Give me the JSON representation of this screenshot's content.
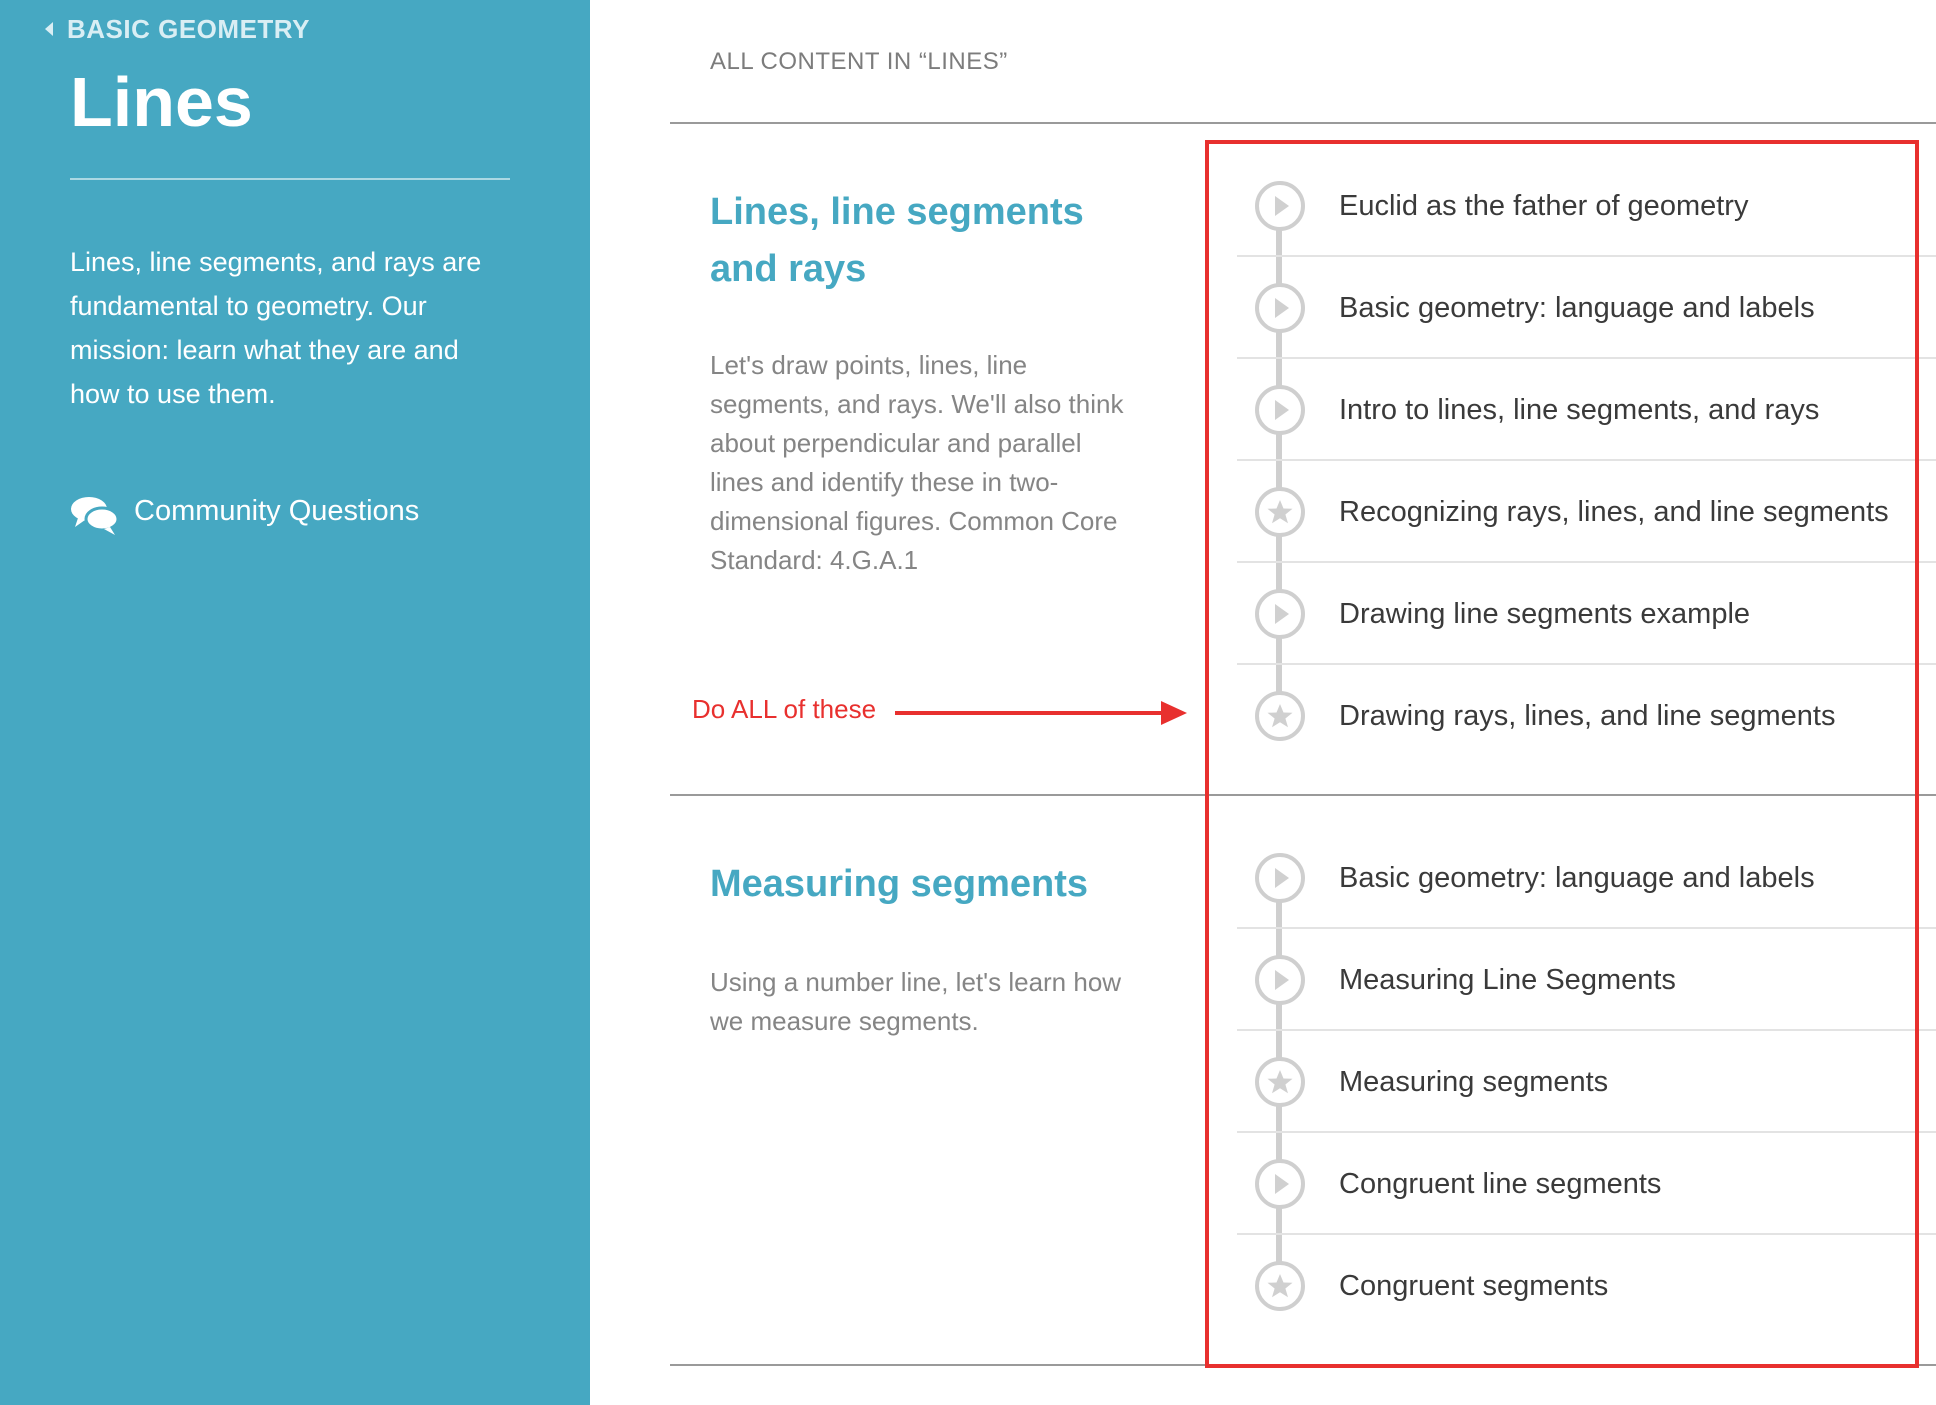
{
  "sidebar": {
    "breadcrumb": "BASIC GEOMETRY",
    "title": "Lines",
    "description": "Lines, line segments, and rays are fundamental to geometry. Our mission: learn what they are and how to use them.",
    "community_label": "Community Questions"
  },
  "main": {
    "header": "ALL CONTENT IN “LINES”",
    "sections": [
      {
        "title": "Lines, line segments and rays",
        "description": "Let's draw points, lines, line segments, and rays. We'll also think about perpendicular and parallel lines and identify these in two-dimensional figures. Common Core Standard: 4.G.A.1",
        "items": [
          {
            "label": "Euclid as the father of geometry",
            "icon": "play-icon"
          },
          {
            "label": "Basic geometry: language and labels",
            "icon": "play-icon"
          },
          {
            "label": "Intro to lines, line segments, and rays",
            "icon": "play-icon"
          },
          {
            "label": "Recognizing rays, lines, and line segments",
            "icon": "star-icon"
          },
          {
            "label": "Drawing line segments example",
            "icon": "play-icon"
          },
          {
            "label": "Drawing rays, lines, and line segments",
            "icon": "star-icon"
          }
        ]
      },
      {
        "title": "Measuring segments",
        "description": "Using a number line, let's learn how we measure segments.",
        "items": [
          {
            "label": "Basic geometry: language and labels",
            "icon": "play-icon"
          },
          {
            "label": "Measuring Line Segments",
            "icon": "play-icon"
          },
          {
            "label": "Measuring segments",
            "icon": "star-icon"
          },
          {
            "label": "Congruent line segments",
            "icon": "play-icon"
          },
          {
            "label": "Congruent segments",
            "icon": "star-icon"
          }
        ]
      }
    ]
  },
  "annotation": {
    "text": "Do ALL of these",
    "color": "#e8302e"
  },
  "colors": {
    "sidebar_bg": "#46a8c2",
    "accent": "#46a8c2",
    "annotation_red": "#e8302e"
  }
}
